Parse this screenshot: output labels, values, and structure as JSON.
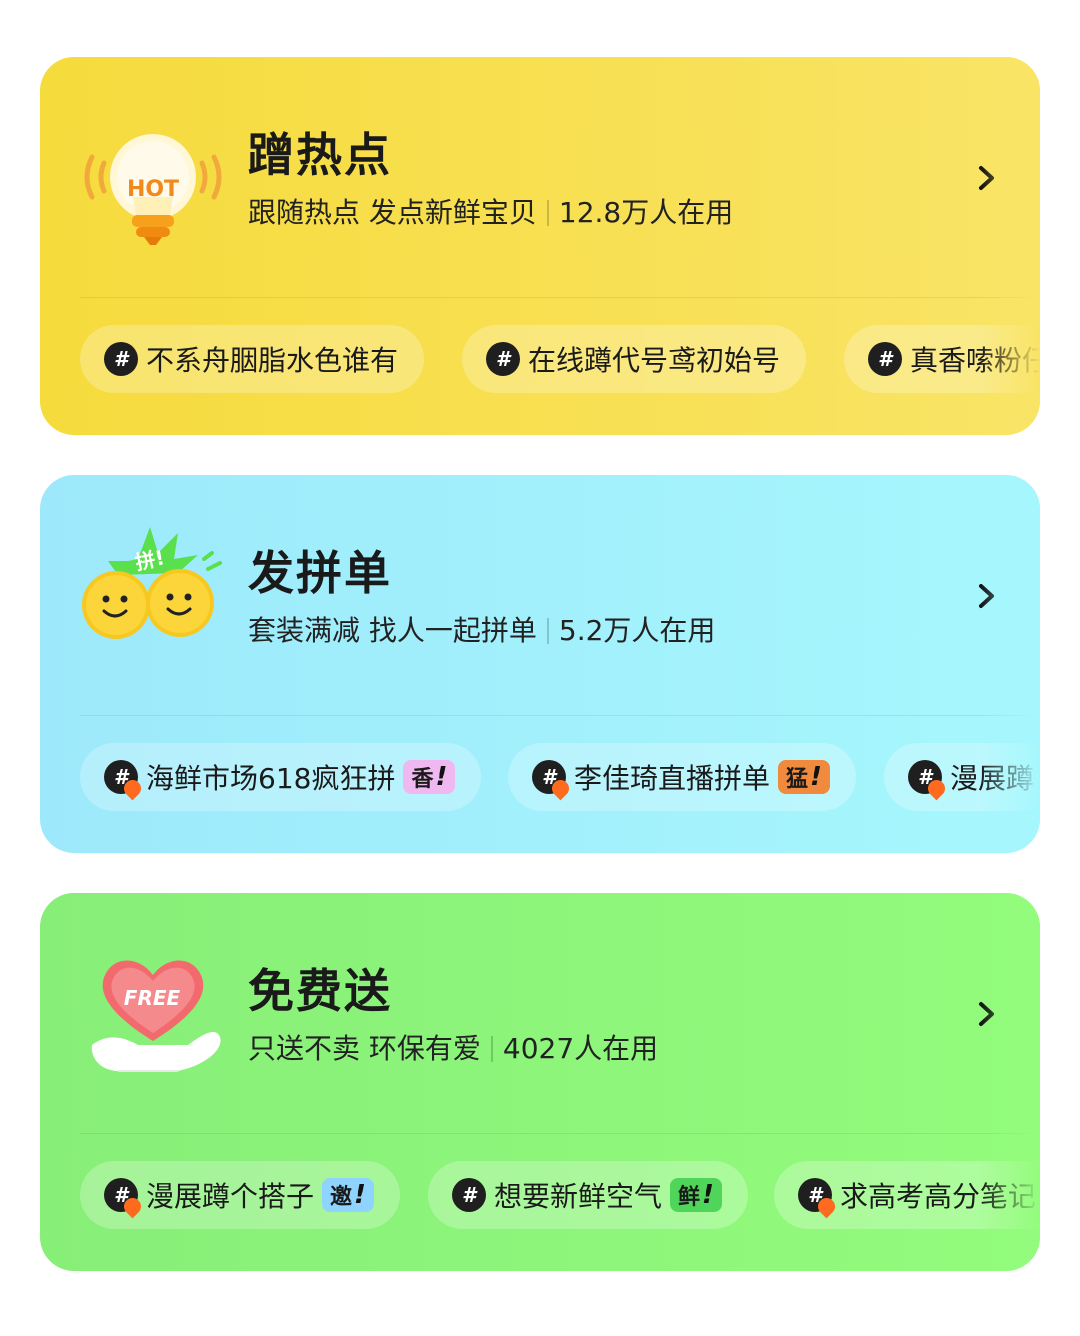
{
  "cards": [
    {
      "title": "蹭热点",
      "desc": "跟随热点 发点新鲜宝贝",
      "users": "12.8万人在用",
      "icon_text": "HOT",
      "icon": "hot-lightbulb-icon",
      "tags": [
        {
          "label": "不系舟胭脂水色谁有"
        },
        {
          "label": "在线蹲代号鸢初始号"
        },
        {
          "label": "真香嗦粉仔"
        }
      ]
    },
    {
      "title": "发拼单",
      "desc": "套装满减 找人一起拼单",
      "users": "5.2万人在用",
      "icon_text": "拼!",
      "icon": "smiley-faces-icon",
      "tags": [
        {
          "label": "海鲜市场618疯狂拼",
          "badge": "香",
          "badge_color": "#f0b8f0"
        },
        {
          "label": "李佳琦直播拼单",
          "badge": "猛",
          "badge_color": "#f08a3c"
        },
        {
          "label": "漫展蹲"
        }
      ]
    },
    {
      "title": "免费送",
      "desc": "只送不卖 环保有爱",
      "users": "4027人在用",
      "icon_text": "FREE",
      "icon": "heart-hand-icon",
      "tags": [
        {
          "label": "漫展蹲个搭子",
          "badge": "邀",
          "badge_color": "#8fd4ff"
        },
        {
          "label": "想要新鲜空气",
          "badge": "鲜",
          "badge_color": "#4fd65a"
        },
        {
          "label": "求高考高分笔记"
        }
      ]
    }
  ],
  "bang": "!"
}
